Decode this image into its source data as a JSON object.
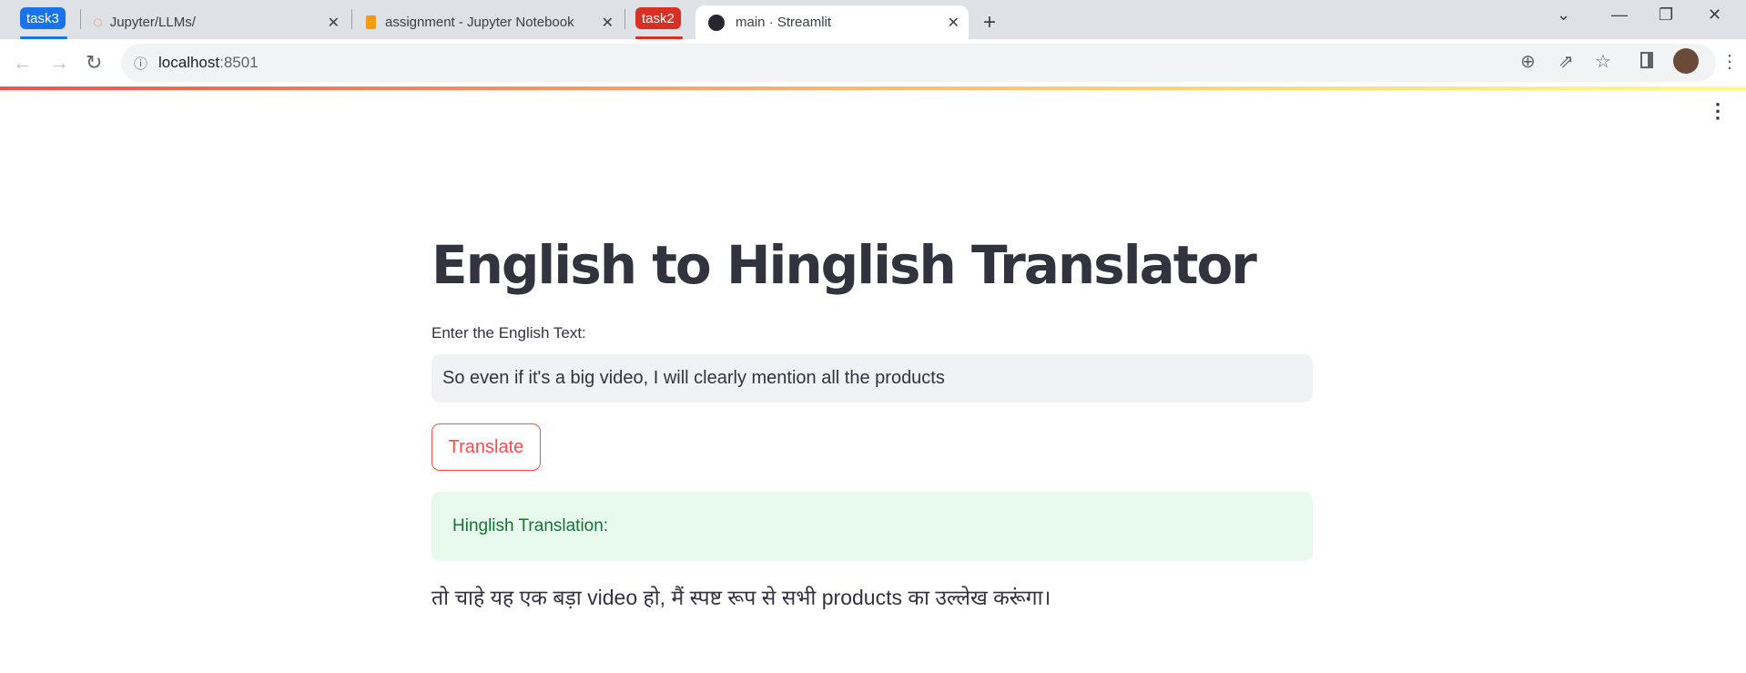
{
  "browser": {
    "tabs": [
      {
        "group": "task3",
        "group_color": "#1a73e8"
      },
      {
        "title": "Jupyter/LLMs/",
        "icon": "jupyter-icon"
      },
      {
        "title": "assignment - Jupyter Notebook",
        "icon": "notebook-icon"
      },
      {
        "group": "task2",
        "group_color": "#d93025"
      },
      {
        "title": "main · Streamlit",
        "icon": "streamlit-icon",
        "active": true
      }
    ],
    "new_tab": "+",
    "url_host": "localhost",
    "url_port": ":8501"
  },
  "app": {
    "title": "English to Hinglish Translator",
    "input_label": "Enter the English Text:",
    "input_value": "So even if it's a big video, I will clearly mention all the products",
    "button": "Translate",
    "success_label": "Hinglish Translation:",
    "result": "तो चाहे यह एक बड़ा video हो, मैं स्पष्ट रूप से सभी products का उल्लेख करूंगा।",
    "accent": "#ff4b4b"
  }
}
